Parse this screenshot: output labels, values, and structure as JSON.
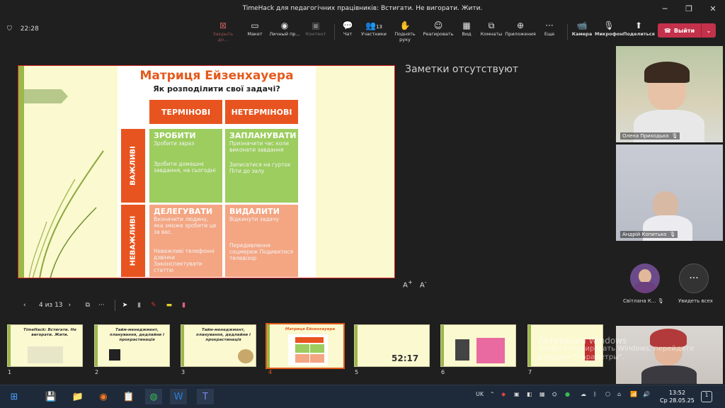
{
  "window": {
    "title": "TimeHack для педагогічних працівників: Встигати. Не вигорати. Жити."
  },
  "toolbar": {
    "duration": "22:28",
    "buttons": [
      {
        "label": "Закрыть до...",
        "icon": "close-share-icon"
      },
      {
        "label": "Макет",
        "icon": "layout-icon"
      },
      {
        "label": "Личный пр...",
        "icon": "private-view-icon"
      },
      {
        "label": "Контент",
        "icon": "content-icon"
      },
      {
        "label": "Чат",
        "icon": "chat-icon"
      },
      {
        "label": "Участники",
        "icon": "participants-icon",
        "count": "13"
      },
      {
        "label": "Поднять руку",
        "icon": "raise-hand-icon"
      },
      {
        "label": "Реагировать",
        "icon": "react-icon"
      },
      {
        "label": "Вид",
        "icon": "view-icon"
      },
      {
        "label": "Комнаты",
        "icon": "rooms-icon"
      },
      {
        "label": "Приложения",
        "icon": "apps-icon"
      },
      {
        "label": "Еще",
        "icon": "more-icon"
      },
      {
        "label": "Камера",
        "icon": "camera-icon"
      },
      {
        "label": "Микрофон",
        "icon": "mic-icon"
      },
      {
        "label": "Поделиться",
        "icon": "share-icon"
      }
    ],
    "leave_label": "Выйти"
  },
  "slide": {
    "title": "Матриця Ейзенхауера",
    "subtitle": "Як розподілити свої задачі?",
    "col1": "ТЕРМІНОВІ",
    "col2": "НЕТЕРМІНОВІ",
    "row1": "ВАЖЛИВІ",
    "row2": "НЕВАЖЛИВІ",
    "q1": {
      "head": "ЗРОБИТИ",
      "l1": "Зробити зараз",
      "l2": "Зробити домашнє завдання, на сьогодні"
    },
    "q2": {
      "head": "ЗАПЛАНУВАТИ",
      "l1": "Призначити час коли виконати завдання",
      "l2": "Записатися на гурток Піти до залу"
    },
    "q3": {
      "head": "ДЕЛЕГУВАТИ",
      "l1": "Визначити людину, яка зможе зробити це за вас.",
      "l2": "Неважливі телефонні дзвінки Законспектувати статтю"
    },
    "q4": {
      "head": "ВИДАЛИТИ",
      "l1": "Відкинути задачу",
      "l2": "Передивлення соцмереж Подивитися телевізор"
    }
  },
  "notes": "Заметки отсутствуют",
  "slide_controls": {
    "counter": "4 из 13"
  },
  "participants": [
    {
      "name": "Олена Приходько"
    },
    {
      "name": "Андрій Копитько"
    },
    {
      "name": "Світлана К..."
    }
  ],
  "see_all": "Увидеть всех",
  "thumbnails": [
    {
      "num": "1",
      "title": "TimeHack: Встигати. Не вигорати. Жити."
    },
    {
      "num": "2",
      "title": "Тайм-менеджмент, планування, дедлайни і прокрастинація"
    },
    {
      "num": "3",
      "title": "Тайм-менеджмент, планування, дедлайни і прокрастинація"
    },
    {
      "num": "4",
      "title": "Матриця Ейзенхауера"
    },
    {
      "num": "5",
      "title": "52:17"
    },
    {
      "num": "6",
      "title": ""
    },
    {
      "num": "7",
      "title": ""
    }
  ],
  "watermark": {
    "l1": "Активация Windows",
    "l2": "Чтобы активировать Windows, перейдите",
    "l3": "в раздел \"Параметры\"."
  },
  "taskbar": {
    "lang": "UK",
    "time": "13:52",
    "date": "Ср 28.05.25",
    "badge": "1"
  }
}
